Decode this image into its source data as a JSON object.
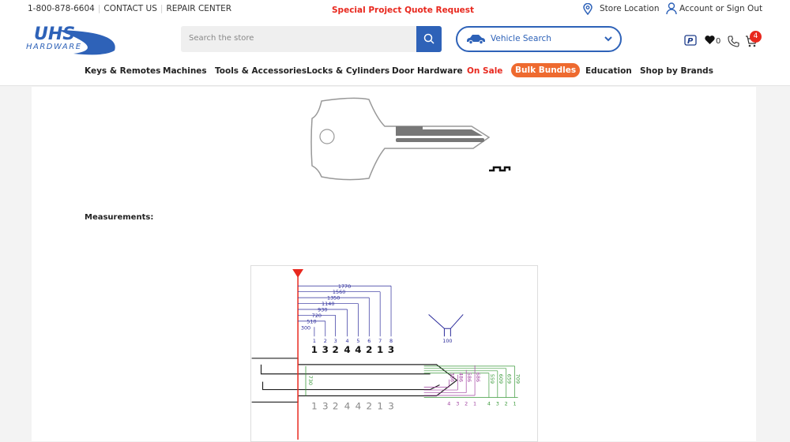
{
  "topbar": {
    "phone": "1-800-878-6604",
    "contact": "CONTACT US",
    "repair": "REPAIR CENTER",
    "quote": "Special Project Quote Request",
    "store": "Store Location",
    "account": "Account or Sign Out"
  },
  "logo": {
    "text": "UHS",
    "sub": "HARDWARE"
  },
  "search": {
    "placeholder": "Search the store"
  },
  "vehicle": {
    "label": "Vehicle Search"
  },
  "icons": {
    "wishlist_count": "0",
    "cart_count": "4"
  },
  "nav": [
    "Keys & Remotes",
    "Machines",
    "Tools & Accessories",
    "Locks & Cylinders",
    "Door Hardware",
    "On Sale",
    "Bulk Bundles",
    "Education",
    "Shop by Brands"
  ],
  "colors": {
    "brand_blue": "#2e62b8",
    "sale_red": "#e8281e",
    "bulk_orange": "#ee6a2f"
  },
  "content": {
    "measurements_label": "Measurements:"
  },
  "diagram": {
    "spacings": [
      "300",
      "510",
      "720",
      "930",
      "1140",
      "1350",
      "1560",
      "1770"
    ],
    "positions": [
      "1",
      "2",
      "3",
      "4",
      "5",
      "6",
      "7",
      "8"
    ],
    "cuts": [
      "1",
      "3",
      "2",
      "4",
      "4",
      "2",
      "1",
      "3"
    ],
    "blade_width": "730",
    "cut_width": "100",
    "purple_depths": [
      "386",
      "486",
      "586",
      "686"
    ],
    "purple_labels": [
      "4",
      "3",
      "2",
      "1"
    ],
    "green_depths": [
      "559",
      "609",
      "659",
      "709"
    ],
    "green_labels": [
      "4",
      "3",
      "2",
      "1"
    ]
  }
}
